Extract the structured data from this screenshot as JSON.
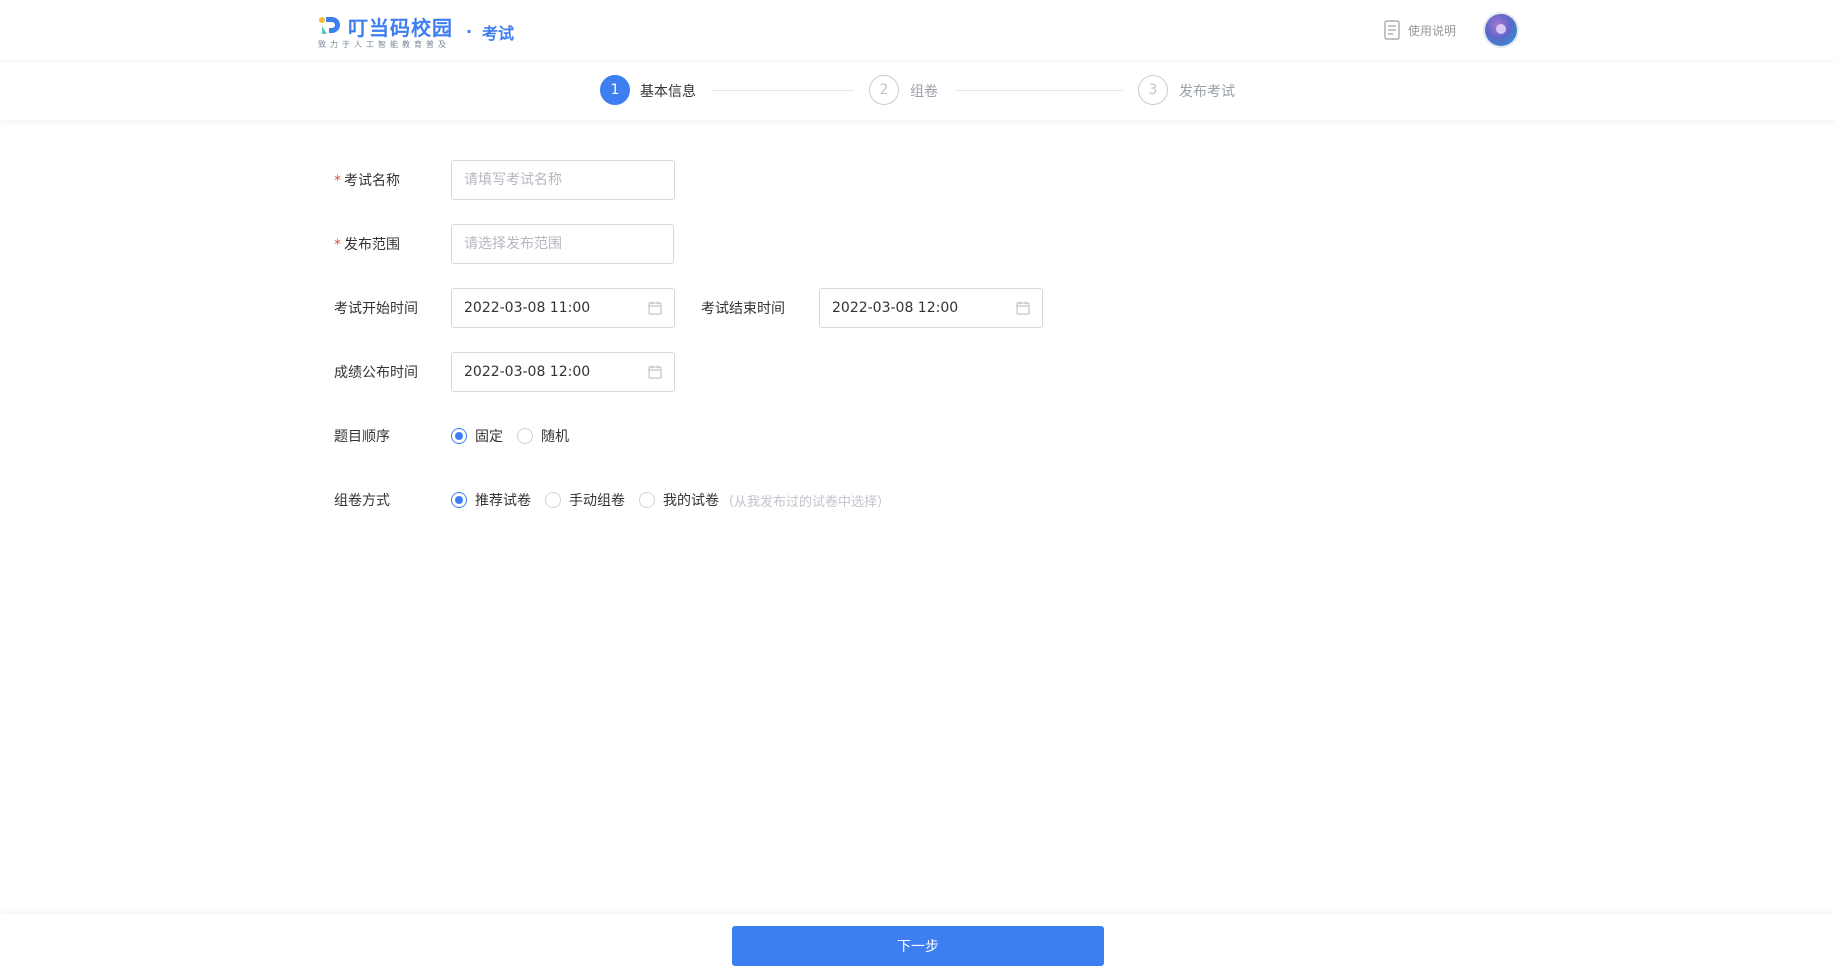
{
  "header": {
    "brand_name": "叮当码校园",
    "brand_slogan": "致力于人工智能教育普及",
    "section_separator": "·",
    "section_title": "考试",
    "help_label": "使用说明",
    "help_icon": "document-icon",
    "avatar_icon": "avatar"
  },
  "stepper": {
    "steps": [
      {
        "number": "1",
        "label": "基本信息",
        "state": "active"
      },
      {
        "number": "2",
        "label": "组卷",
        "state": "todo"
      },
      {
        "number": "3",
        "label": "发布考试",
        "state": "todo"
      }
    ]
  },
  "form": {
    "required_mark": "*",
    "exam_name": {
      "label": "考试名称",
      "value": "",
      "placeholder": "请填写考试名称",
      "required": true
    },
    "scope": {
      "label": "发布范围",
      "value": "",
      "placeholder": "请选择发布范围",
      "required": true
    },
    "start_time": {
      "label": "考试开始时间",
      "value": "2022-03-08 11:00"
    },
    "end_time": {
      "label": "考试结束时间",
      "value": "2022-03-08 12:00"
    },
    "score_time": {
      "label": "成绩公布时间",
      "value": "2022-03-08 12:00"
    },
    "question_order": {
      "label": "题目顺序",
      "options": [
        {
          "label": "固定",
          "checked": true
        },
        {
          "label": "随机",
          "checked": false
        }
      ]
    },
    "compose_mode": {
      "label": "组卷方式",
      "options": [
        {
          "label": "推荐试卷",
          "checked": true
        },
        {
          "label": "手动组卷",
          "checked": false
        },
        {
          "label": "我的试卷",
          "checked": false
        }
      ],
      "hint": "（从我发布过的试卷中选择）"
    }
  },
  "footer": {
    "next_label": "下一步"
  },
  "colors": {
    "primary": "#3d7ef0",
    "required": "#f04c4c"
  }
}
